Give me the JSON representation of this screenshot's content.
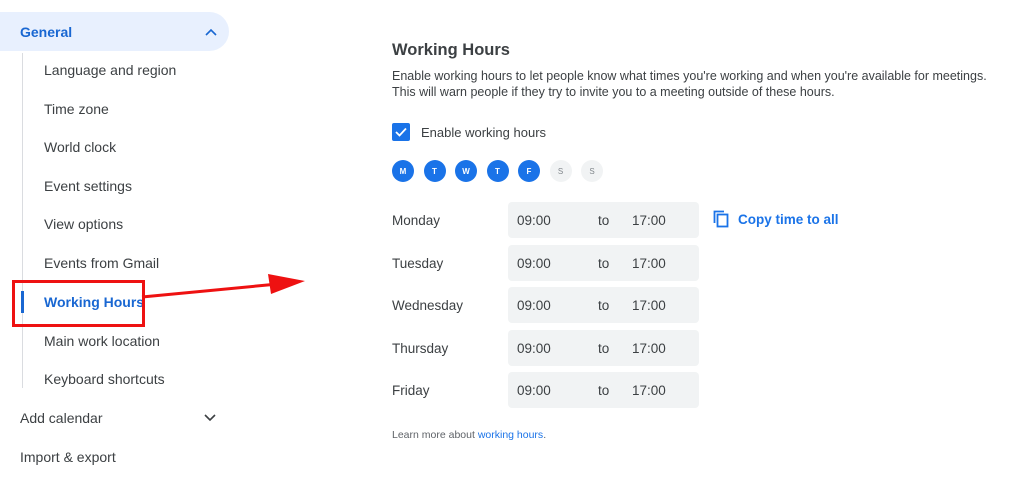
{
  "sidebar": {
    "general_label": "General",
    "sub_items": [
      {
        "label": "Language and region"
      },
      {
        "label": "Time zone"
      },
      {
        "label": "World clock"
      },
      {
        "label": "Event settings"
      },
      {
        "label": "View options"
      },
      {
        "label": "Events from Gmail"
      },
      {
        "label": "Working Hours"
      },
      {
        "label": "Main work location"
      },
      {
        "label": "Keyboard shortcuts"
      }
    ],
    "add_calendar": "Add calendar",
    "import_export": "Import & export"
  },
  "main": {
    "title": "Working Hours",
    "description": "Enable working hours to let people know what times you're working and when you're available for meetings. This will warn people if they try to invite you to a meeting outside of these hours.",
    "enable_label": "Enable working hours",
    "enable_checked": true,
    "days": [
      {
        "letter": "M",
        "on": true
      },
      {
        "letter": "T",
        "on": true
      },
      {
        "letter": "W",
        "on": true
      },
      {
        "letter": "T",
        "on": true
      },
      {
        "letter": "F",
        "on": true
      },
      {
        "letter": "S",
        "on": false
      },
      {
        "letter": "S",
        "on": false
      }
    ],
    "hours": [
      {
        "day": "Monday",
        "start": "09:00",
        "to": "to",
        "end": "17:00"
      },
      {
        "day": "Tuesday",
        "start": "09:00",
        "to": "to",
        "end": "17:00"
      },
      {
        "day": "Wednesday",
        "start": "09:00",
        "to": "to",
        "end": "17:00"
      },
      {
        "day": "Thursday",
        "start": "09:00",
        "to": "to",
        "end": "17:00"
      },
      {
        "day": "Friday",
        "start": "09:00",
        "to": "to",
        "end": "17:00"
      }
    ],
    "copy_label": "Copy time to all",
    "learn_prefix": "Learn more about ",
    "learn_link": "working hours",
    "learn_suffix": "."
  },
  "colors": {
    "accent": "#1a73e8",
    "active_text": "#1967d2",
    "active_bg": "#e8f0fe",
    "annotation": "#ee1111"
  },
  "icons": [
    "chevron-up-icon",
    "chevron-down-icon",
    "checkmark-icon",
    "copy-icon",
    "arrow-icon"
  ]
}
